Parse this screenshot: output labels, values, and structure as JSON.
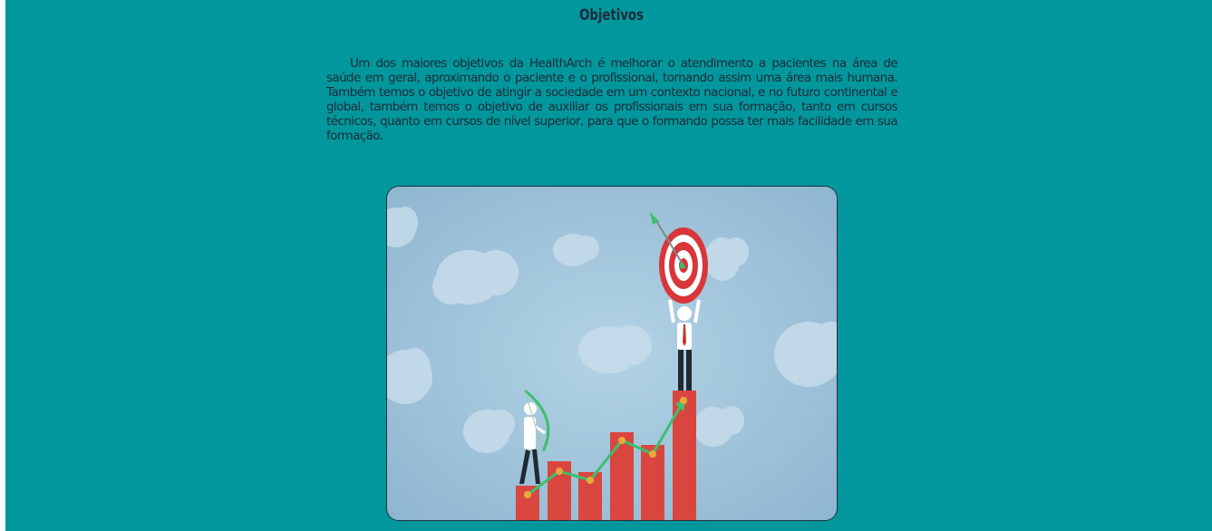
{
  "section": {
    "title": "Objetivos",
    "paragraph": "Um dos maiores objetivos da HealthArch é melhorar o atendimento a pacientes na área de saúde em geral, aproximando o paciente e o profissional, tornando assim uma área mais humana. Também temos o objetivo de atingir a sociedade em um contexto nacional, e no futuro continental e global, também temos o objetivo de auxiliar os profissionais em sua formação, tanto em cursos técnicos, quanto em cursos de nível superior, para que o formando possa ter mais facilidade em sua formação."
  },
  "illustration": {
    "icon": "goal-achievement-illustration"
  },
  "colors": {
    "page_background": "#02979c",
    "text": "#1d2b3a",
    "bars": "#d9463f",
    "arrow_line": "#3cbf6f",
    "target_red": "#d8363a"
  }
}
